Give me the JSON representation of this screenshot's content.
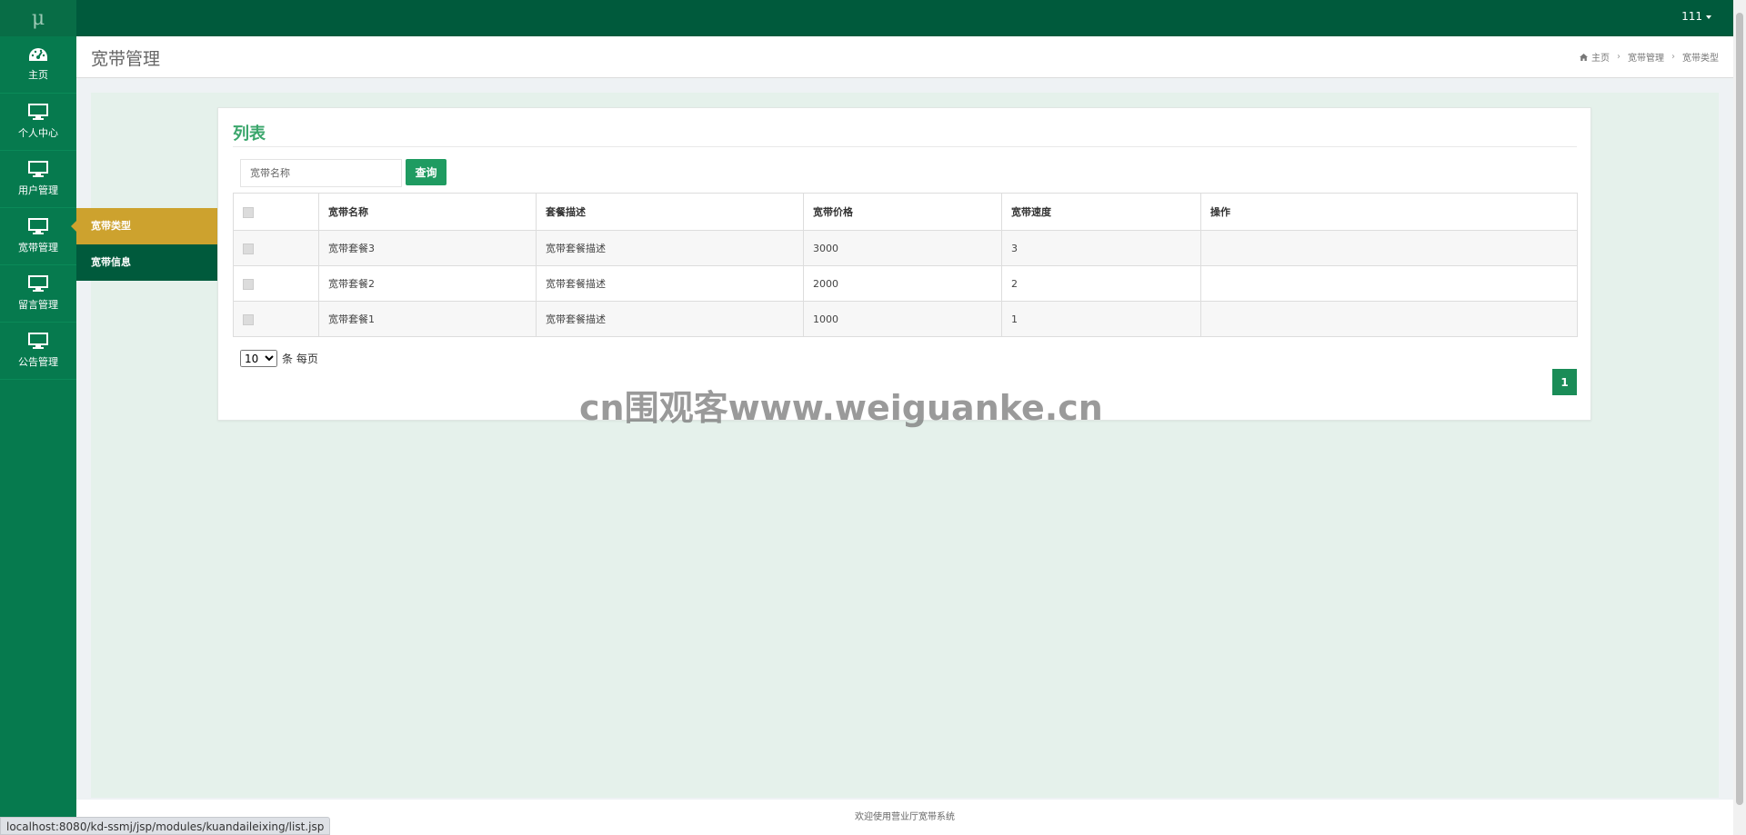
{
  "app": {
    "logo_text": "μ"
  },
  "user_menu": {
    "label": "111"
  },
  "sidebar": {
    "items": [
      {
        "label": "主页",
        "icon": "dashboard-icon"
      },
      {
        "label": "个人中心",
        "icon": "monitor-icon"
      },
      {
        "label": "用户管理",
        "icon": "monitor-icon"
      },
      {
        "label": "宽带管理",
        "icon": "monitor-icon"
      },
      {
        "label": "留言管理",
        "icon": "monitor-icon"
      },
      {
        "label": "公告管理",
        "icon": "monitor-icon"
      }
    ]
  },
  "submenu": {
    "items": [
      {
        "label": "宽带类型",
        "active": true
      },
      {
        "label": "宽带信息",
        "active": false
      }
    ]
  },
  "header": {
    "title": "宽带管理",
    "breadcrumb": [
      "主页",
      "宽带管理",
      "宽带类型"
    ]
  },
  "card": {
    "title": "列表",
    "search": {
      "placeholder": "宽带名称",
      "value": ""
    },
    "search_button": "查询"
  },
  "table": {
    "columns": [
      "宽带名称",
      "套餐描述",
      "宽带价格",
      "宽带速度",
      "操作"
    ],
    "rows": [
      {
        "name": "宽带套餐3",
        "desc": "宽带套餐描述",
        "price": "3000",
        "speed": "3",
        "ops": ""
      },
      {
        "name": "宽带套餐2",
        "desc": "宽带套餐描述",
        "price": "2000",
        "speed": "2",
        "ops": ""
      },
      {
        "name": "宽带套餐1",
        "desc": "宽带套餐描述",
        "price": "1000",
        "speed": "1",
        "ops": ""
      }
    ]
  },
  "pagination": {
    "page_size": "10",
    "page_size_suffix": "条 每页",
    "current_page": "1"
  },
  "watermark": "cn围观客www.weiguanke.cn",
  "footer": {
    "text": "欢迎使用营业厅宽带系统"
  },
  "status_url": "localhost:8080/kd-ssmj/jsp/modules/kuandaileixing/list.jsp",
  "colors": {
    "topbar": "#005a3c",
    "sidebar": "#067a4e",
    "submenu_active": "#cda22e",
    "accent": "#1f9b61",
    "title_green": "#3aa66b"
  }
}
